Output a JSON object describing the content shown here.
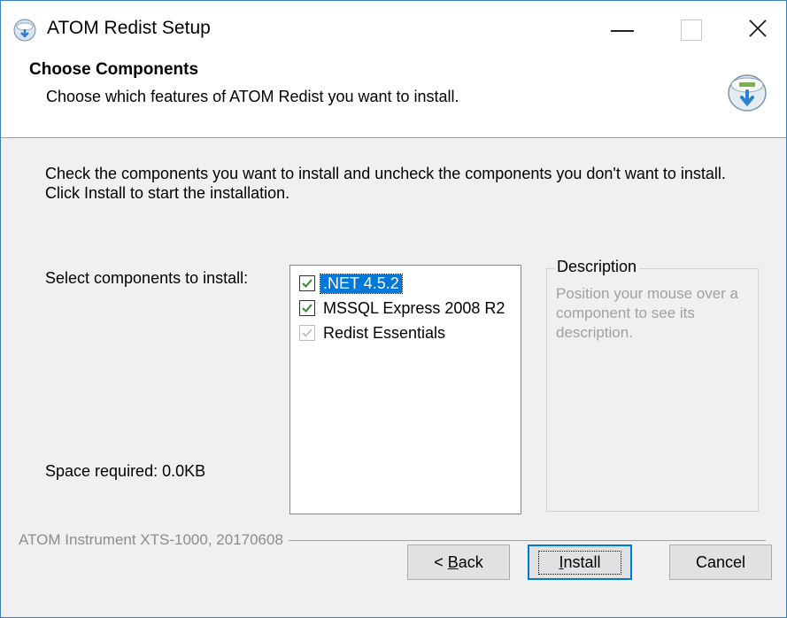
{
  "window": {
    "title": "ATOM Redist Setup"
  },
  "header": {
    "title": "Choose Components",
    "subtitle": "Choose which features of ATOM Redist you want to install."
  },
  "instructions": "Check the components you want to install and uncheck the components you don't want to install. Click Install to start the installation.",
  "select_label": "Select components to install:",
  "components": [
    {
      "label": ".NET 4.5.2",
      "checked": true,
      "selected": true,
      "disabled": false
    },
    {
      "label": "MSSQL Express 2008 R2",
      "checked": true,
      "selected": false,
      "disabled": false
    },
    {
      "label": "Redist Essentials",
      "checked": true,
      "selected": false,
      "disabled": true
    }
  ],
  "description": {
    "legend": "Description",
    "text": "Position your mouse over a component to see its description."
  },
  "space_required": "Space required: 0.0KB",
  "branding": "ATOM Instrument XTS-1000, 20170608",
  "buttons": {
    "back_prefix": "< ",
    "back_mnemonic": "B",
    "back_rest": "ack",
    "install_mnemonic": "I",
    "install_rest": "nstall",
    "cancel": "Cancel"
  },
  "colors": {
    "accent": "#0078d7",
    "check": "#2e8b2e",
    "window_border": "#3c7fb1"
  }
}
